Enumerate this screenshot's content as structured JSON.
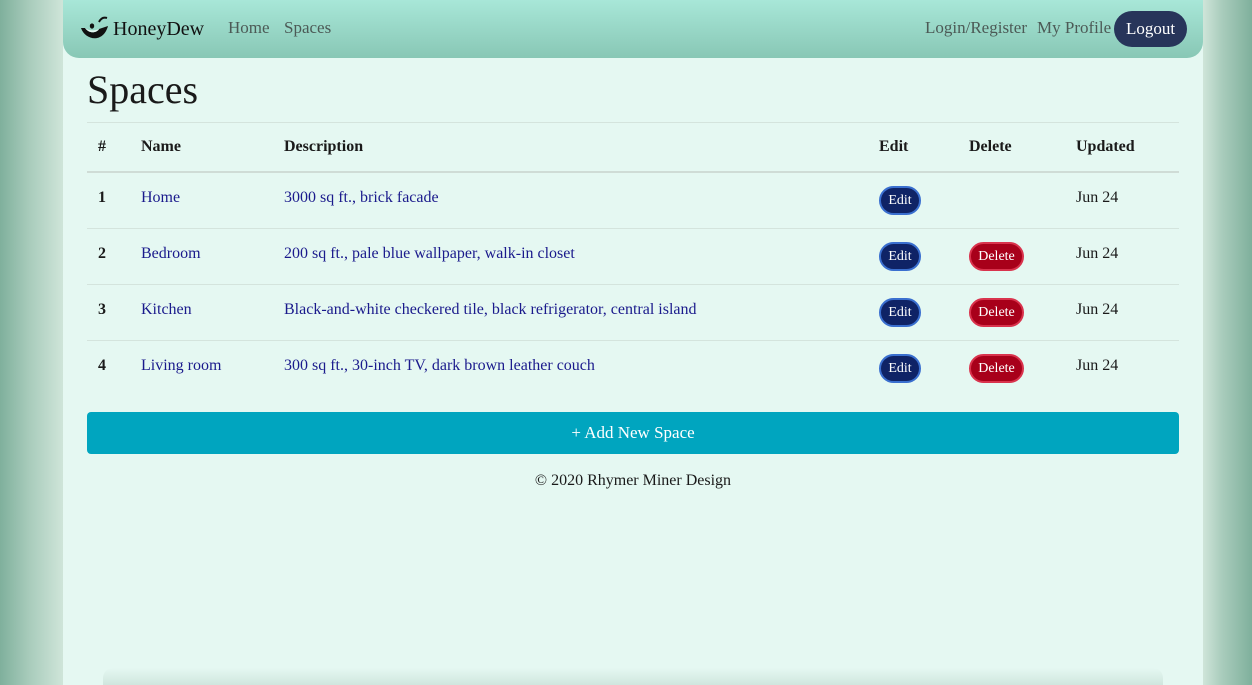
{
  "navbar": {
    "brand": "HoneyDew",
    "links": [
      "Home",
      "Spaces"
    ],
    "login_register": "Login/Register",
    "my_profile": "My Profile",
    "logout": "Logout"
  },
  "page": {
    "title": "Spaces"
  },
  "table": {
    "headers": {
      "num": "#",
      "name": "Name",
      "description": "Description",
      "edit": "Edit",
      "delete": "Delete",
      "updated": "Updated"
    },
    "rows": [
      {
        "num": "1",
        "name": "Home",
        "description": "3000 sq ft., brick facade",
        "edit": "Edit",
        "delete": "",
        "updated": "Jun 24"
      },
      {
        "num": "2",
        "name": "Bedroom",
        "description": "200 sq ft., pale blue wallpaper, walk-in closet",
        "edit": "Edit",
        "delete": "Delete",
        "updated": "Jun 24"
      },
      {
        "num": "3",
        "name": "Kitchen",
        "description": "Black-and-white checkered tile, black refrigerator, central island",
        "edit": "Edit",
        "delete": "Delete",
        "updated": "Jun 24"
      },
      {
        "num": "4",
        "name": "Living room",
        "description": "300 sq ft., 30-inch TV, dark brown leather couch",
        "edit": "Edit",
        "delete": "Delete",
        "updated": "Jun 24"
      }
    ]
  },
  "actions": {
    "add_new_space": "+ Add New Space"
  },
  "footer": {
    "copyright": "© 2020 Rhymer Miner Design"
  },
  "colors": {
    "navbar": "#9fdccd",
    "logout_button": "#27355a",
    "edit_button": "#0f2366",
    "delete_button": "#a8001a",
    "add_button": "#00a5bf",
    "link": "#1a1a8c"
  },
  "icons": {
    "brand": "honeydew-melon-logo-icon"
  }
}
